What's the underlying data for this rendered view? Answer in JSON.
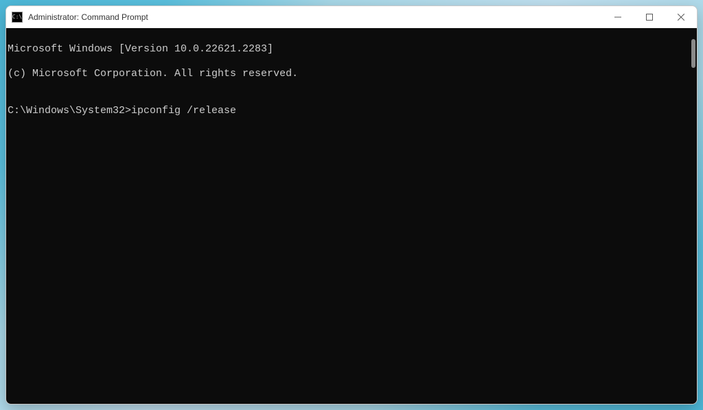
{
  "window": {
    "title": "Administrator: Command Prompt"
  },
  "terminal": {
    "line1": "Microsoft Windows [Version 10.0.22621.2283]",
    "line2": "(c) Microsoft Corporation. All rights reserved.",
    "blank": "",
    "prompt": "C:\\Windows\\System32>",
    "command": "ipconfig /release"
  }
}
